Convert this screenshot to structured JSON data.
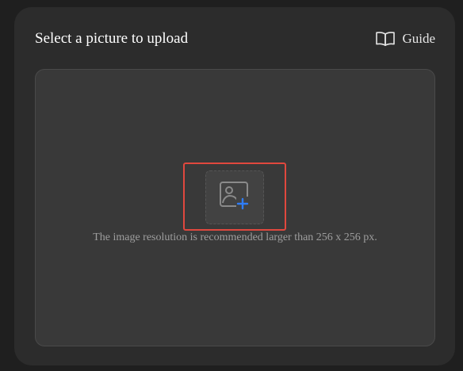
{
  "header": {
    "title": "Select a picture to upload",
    "guide_label": "Guide",
    "guide_icon": "book-open-icon"
  },
  "dropzone": {
    "upload_icon": "image-add-icon",
    "hint": "The image resolution is recommended larger than 256 x 256 px.",
    "accent_color": "#2f7df6",
    "highlight_color": "#e0483e"
  }
}
